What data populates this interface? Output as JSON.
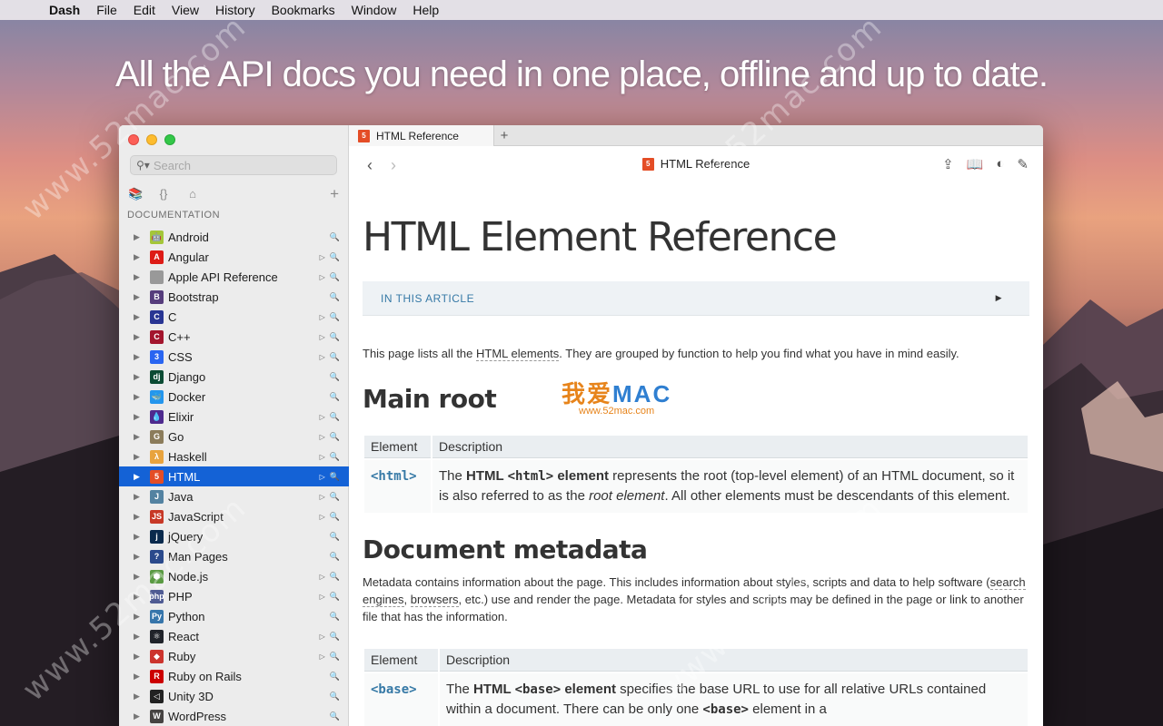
{
  "menubar": {
    "app": "Dash",
    "items": [
      "File",
      "Edit",
      "View",
      "History",
      "Bookmarks",
      "Window",
      "Help"
    ]
  },
  "headline": "All the API docs you need in one place, offline and up to date.",
  "watermarks": [
    "www.52mac.com",
    "www.52mac.com",
    "www.52mac.com",
    "www.52mac.com",
    "www.52mac.com"
  ],
  "sidebar": {
    "search_placeholder": "Search",
    "section_label": "DOCUMENTATION",
    "docs": [
      {
        "name": "Android",
        "icon": "android-icon",
        "color": "#a4c639",
        "glyph": "🤖",
        "play": false
      },
      {
        "name": "Angular",
        "icon": "angular-icon",
        "color": "#dd1b16",
        "glyph": "A",
        "play": true
      },
      {
        "name": "Apple API Reference",
        "icon": "apple-icon",
        "color": "#999999",
        "glyph": "",
        "play": true
      },
      {
        "name": "Bootstrap",
        "icon": "bootstrap-icon",
        "color": "#563d7c",
        "glyph": "B",
        "play": false
      },
      {
        "name": "C",
        "icon": "c-icon",
        "color": "#283593",
        "glyph": "C",
        "play": true
      },
      {
        "name": "C++",
        "icon": "cpp-icon",
        "color": "#a3152d",
        "glyph": "C",
        "play": true
      },
      {
        "name": "CSS",
        "icon": "css-icon",
        "color": "#2965f1",
        "glyph": "3",
        "play": true
      },
      {
        "name": "Django",
        "icon": "django-icon",
        "color": "#0c4b33",
        "glyph": "dj",
        "play": false
      },
      {
        "name": "Docker",
        "icon": "docker-icon",
        "color": "#2496ed",
        "glyph": "🐳",
        "play": false
      },
      {
        "name": "Elixir",
        "icon": "elixir-icon",
        "color": "#4e2a8e",
        "glyph": "💧",
        "play": true
      },
      {
        "name": "Go",
        "icon": "go-icon",
        "color": "#8b7c5b",
        "glyph": "G",
        "play": true
      },
      {
        "name": "Haskell",
        "icon": "haskell-icon",
        "color": "#e8a33d",
        "glyph": "λ",
        "play": true
      },
      {
        "name": "HTML",
        "icon": "html-icon",
        "color": "#e44d26",
        "glyph": "5",
        "play": true
      },
      {
        "name": "Java",
        "icon": "java-icon",
        "color": "#5382a1",
        "glyph": "J",
        "play": true
      },
      {
        "name": "JavaScript",
        "icon": "javascript-icon",
        "color": "#c73826",
        "glyph": "JS",
        "play": true
      },
      {
        "name": "jQuery",
        "icon": "jquery-icon",
        "color": "#0a2a4d",
        "glyph": "j",
        "play": false
      },
      {
        "name": "Man Pages",
        "icon": "man-pages-icon",
        "color": "#2b4a8c",
        "glyph": "?",
        "play": false
      },
      {
        "name": "Node.js",
        "icon": "nodejs-icon",
        "color": "#5a9a42",
        "glyph": "⬢",
        "play": true
      },
      {
        "name": "PHP",
        "icon": "php-icon",
        "color": "#4f5b93",
        "glyph": "php",
        "play": true
      },
      {
        "name": "Python",
        "icon": "python-icon",
        "color": "#3776ab",
        "glyph": "Py",
        "play": false
      },
      {
        "name": "React",
        "icon": "react-icon",
        "color": "#20232a",
        "glyph": "⚛",
        "play": true
      },
      {
        "name": "Ruby",
        "icon": "ruby-icon",
        "color": "#cc342d",
        "glyph": "◆",
        "play": true
      },
      {
        "name": "Ruby on Rails",
        "icon": "rails-icon",
        "color": "#cc0000",
        "glyph": "R",
        "play": false
      },
      {
        "name": "Unity 3D",
        "icon": "unity-icon",
        "color": "#222222",
        "glyph": "◁",
        "play": false
      },
      {
        "name": "WordPress",
        "icon": "wordpress-icon",
        "color": "#464342",
        "glyph": "W",
        "play": false
      }
    ],
    "selected_index": 12
  },
  "tab": {
    "label": "HTML Reference"
  },
  "toolbar": {
    "title": "HTML Reference"
  },
  "article": {
    "title": "HTML Element Reference",
    "in_this_article": "IN THIS ARTICLE",
    "intro_before": "This page lists all the ",
    "intro_link": "HTML elements",
    "intro_after": ". They are grouped by function to help you find what you have in mind easily.",
    "logo_text_cn": "我爱",
    "logo_text": "MAC",
    "logo_url": "www.52mac.com",
    "section1": "Main root",
    "table_headers": [
      "Element",
      "Description"
    ],
    "row1_element": "<html>",
    "row1_pre": "The ",
    "row1_bold_html": "HTML ",
    "row1_code": "<html>",
    "row1_bold_el": " element",
    "row1_mid": " represents the root (top-level element) of an HTML document, so it is also referred to as the ",
    "row1_em": "root element",
    "row1_post": ". All other elements must be descendants of this element.",
    "section2": "Document metadata",
    "meta_1": "Metadata contains information about the page. This includes information about styles, scripts and data to help software (",
    "meta_link1": "search engines",
    "meta_2": ", ",
    "meta_link2": "browsers",
    "meta_3": ", etc.) use and render the page. Metadata for styles and scripts may be defined in the page or link to another file that has the information.",
    "row2_element": "<base>",
    "row2_pre": "The ",
    "row2_bold_html": "HTML ",
    "row2_code": "<base>",
    "row2_bold_el": " element",
    "row2_mid": " specifies the base URL to use for all relative URLs contained within a document. There can be only one ",
    "row2_code2": "<base>",
    "row2_post": " element in a"
  }
}
